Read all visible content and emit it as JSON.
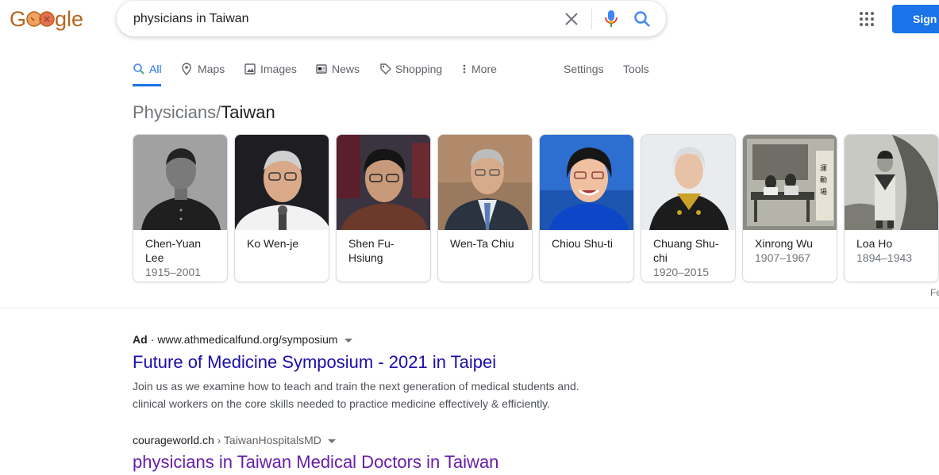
{
  "logo": {
    "text": "Google",
    "colors": [
      "#4285f4",
      "#ea4335",
      "#fbbc05",
      "#34a853"
    ],
    "doodle_color": "#b5651d"
  },
  "search": {
    "query": "physicians in Taiwan",
    "placeholder": ""
  },
  "header": {
    "signin_label": "Sign",
    "accent": "#1a73e8"
  },
  "tabs": [
    {
      "label": "All",
      "icon": "search-icon",
      "active": true
    },
    {
      "label": "Maps",
      "icon": "map-pin-icon"
    },
    {
      "label": "Images",
      "icon": "image-icon"
    },
    {
      "label": "News",
      "icon": "newspaper-icon"
    },
    {
      "label": "Shopping",
      "icon": "tag-icon"
    },
    {
      "label": "More",
      "icon": "more-vert-icon"
    },
    {
      "label": "Settings"
    },
    {
      "label": "Tools"
    }
  ],
  "carousel": {
    "category": "Physicians",
    "separator": "/",
    "location": "Taiwan",
    "feedback": "Fe",
    "people": [
      {
        "name": "Chen-Yuan Lee",
        "years": "1915–2001"
      },
      {
        "name": "Ko Wen-je",
        "years": ""
      },
      {
        "name": "Shen Fu-Hsiung",
        "years": ""
      },
      {
        "name": "Wen-Ta Chiu",
        "years": ""
      },
      {
        "name": "Chiou Shu-ti",
        "years": ""
      },
      {
        "name": "Chuang Shu-chi",
        "years": "1920–2015"
      },
      {
        "name": "Xinrong Wu",
        "years": "1907–1967"
      },
      {
        "name": "Loa Ho",
        "years": "1894–1943"
      }
    ]
  },
  "results": [
    {
      "ad_label": "Ad",
      "separator": "·",
      "url": "www.athmedicalfund.org/symposium",
      "title": "Future of Medicine Symposium - 2021 in Taipei",
      "desc_line1": "Join us as we examine how to teach and train the next generation of medical students and.",
      "desc_line2": "clinical workers on the core skills needed to practice medicine effectively & efficiently."
    },
    {
      "site": "courageworld.ch",
      "crumb": " › TaiwanHospitalsMD",
      "title": "physicians in Taiwan Medical Doctors in Taiwan"
    }
  ]
}
